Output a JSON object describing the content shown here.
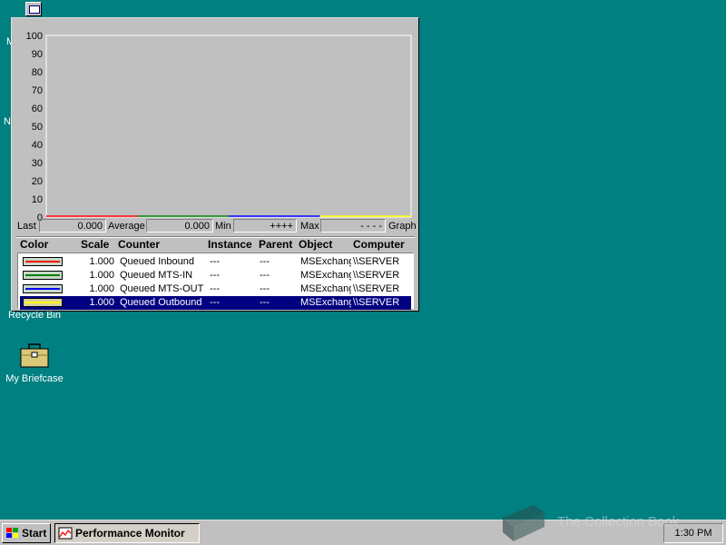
{
  "desktop": {
    "partial_labels": [
      "M",
      "N"
    ],
    "recycle_bin_label": "Recycle Bin",
    "briefcase_label": "My Briefcase"
  },
  "window": {
    "graph": {
      "y_ticks": [
        "100",
        "90",
        "80",
        "70",
        "60",
        "50",
        "40",
        "30",
        "20",
        "10",
        "0"
      ],
      "bg_color": "#c0c0c0"
    },
    "stats": {
      "last_label": "Last",
      "last_value": "0.000",
      "average_label": "Average",
      "average_value": "0.000",
      "min_label": "Min",
      "min_value": "++++",
      "max_label": "Max",
      "max_value": "- - - -",
      "graph_label": "Graph"
    },
    "legend": {
      "headers": {
        "color": "Color",
        "scale": "Scale",
        "counter": "Counter",
        "instance": "Instance",
        "parent": "Parent",
        "object": "Object",
        "computer": "Computer"
      },
      "rows": [
        {
          "color": "#ff0000",
          "scale": "1.000",
          "counter": "Queued Inbound",
          "instance": "---",
          "parent": "---",
          "object": "MSExchangeMTA",
          "computer": "\\\\SERVER"
        },
        {
          "color": "#008000",
          "scale": "1.000",
          "counter": "Queued MTS-IN",
          "instance": "---",
          "parent": "---",
          "object": "MSExchangeMTA",
          "computer": "\\\\SERVER"
        },
        {
          "color": "#0000ff",
          "scale": "1.000",
          "counter": "Queued MTS-OUT",
          "instance": "---",
          "parent": "---",
          "object": "MSExchangeMTA",
          "computer": "\\\\SERVER"
        },
        {
          "color": "#ffff00",
          "scale": "1.000",
          "counter": "Queued Outbound",
          "instance": "---",
          "parent": "---",
          "object": "MSExchangeMTA",
          "computer": "\\\\SERVER"
        }
      ],
      "selected_index": 3
    }
  },
  "taskbar": {
    "start_label": "Start",
    "task_label": "Performance Monitor",
    "clock": "1:30 PM"
  },
  "watermark": {
    "text": "The Collection Book"
  },
  "chart_data": {
    "type": "line",
    "y_range": [
      0,
      100
    ],
    "y_ticks": [
      0,
      10,
      20,
      30,
      40,
      50,
      60,
      70,
      80,
      90,
      100
    ],
    "grid": false,
    "series": [
      {
        "name": "Queued Inbound",
        "color": "#ff0000",
        "values": [
          0
        ]
      },
      {
        "name": "Queued MTS-IN",
        "color": "#008000",
        "values": [
          0
        ]
      },
      {
        "name": "Queued MTS-OUT",
        "color": "#0000ff",
        "values": [
          0
        ]
      },
      {
        "name": "Queued Outbound",
        "color": "#ffff00",
        "values": [
          0
        ]
      }
    ]
  }
}
